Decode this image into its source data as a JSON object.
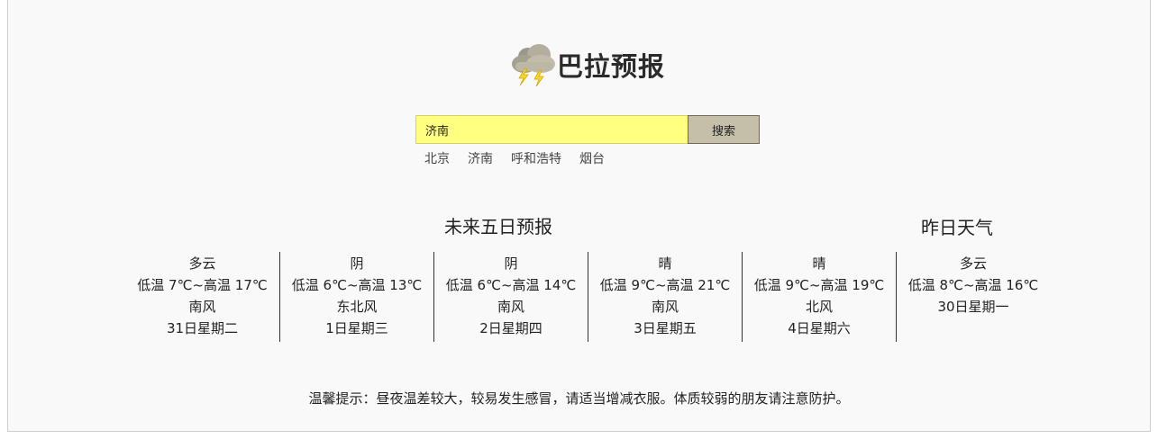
{
  "app": {
    "title": "巴拉预报",
    "logo_icon": "thunderstorm-cloud-icon"
  },
  "search": {
    "value": "济南",
    "button_label": "搜索"
  },
  "quick_cities": [
    "北京",
    "济南",
    "呼和浩特",
    "烟台"
  ],
  "forecast": {
    "heading": "未来五日预报",
    "days": [
      {
        "condition": "多云",
        "temp": "低温 7℃~高温 17℃",
        "wind": "南风",
        "date": "31日星期二"
      },
      {
        "condition": "阴",
        "temp": "低温 6℃~高温 13℃",
        "wind": "东北风",
        "date": "1日星期三"
      },
      {
        "condition": "阴",
        "temp": "低温 6℃~高温 14℃",
        "wind": "南风",
        "date": "2日星期四"
      },
      {
        "condition": "晴",
        "temp": "低温 9℃~高温 21℃",
        "wind": "南风",
        "date": "3日星期五"
      },
      {
        "condition": "晴",
        "temp": "低温 9℃~高温 19℃",
        "wind": "北风",
        "date": "4日星期六"
      }
    ]
  },
  "yesterday": {
    "heading": "昨日天气",
    "condition": "多云",
    "temp": "低温 8℃~高温 16℃",
    "date": "30日星期一"
  },
  "tip": "温馨提示：昼夜温差较大，较易发生感冒，请适当增减衣服。体质较弱的朋友请注意防护。"
}
